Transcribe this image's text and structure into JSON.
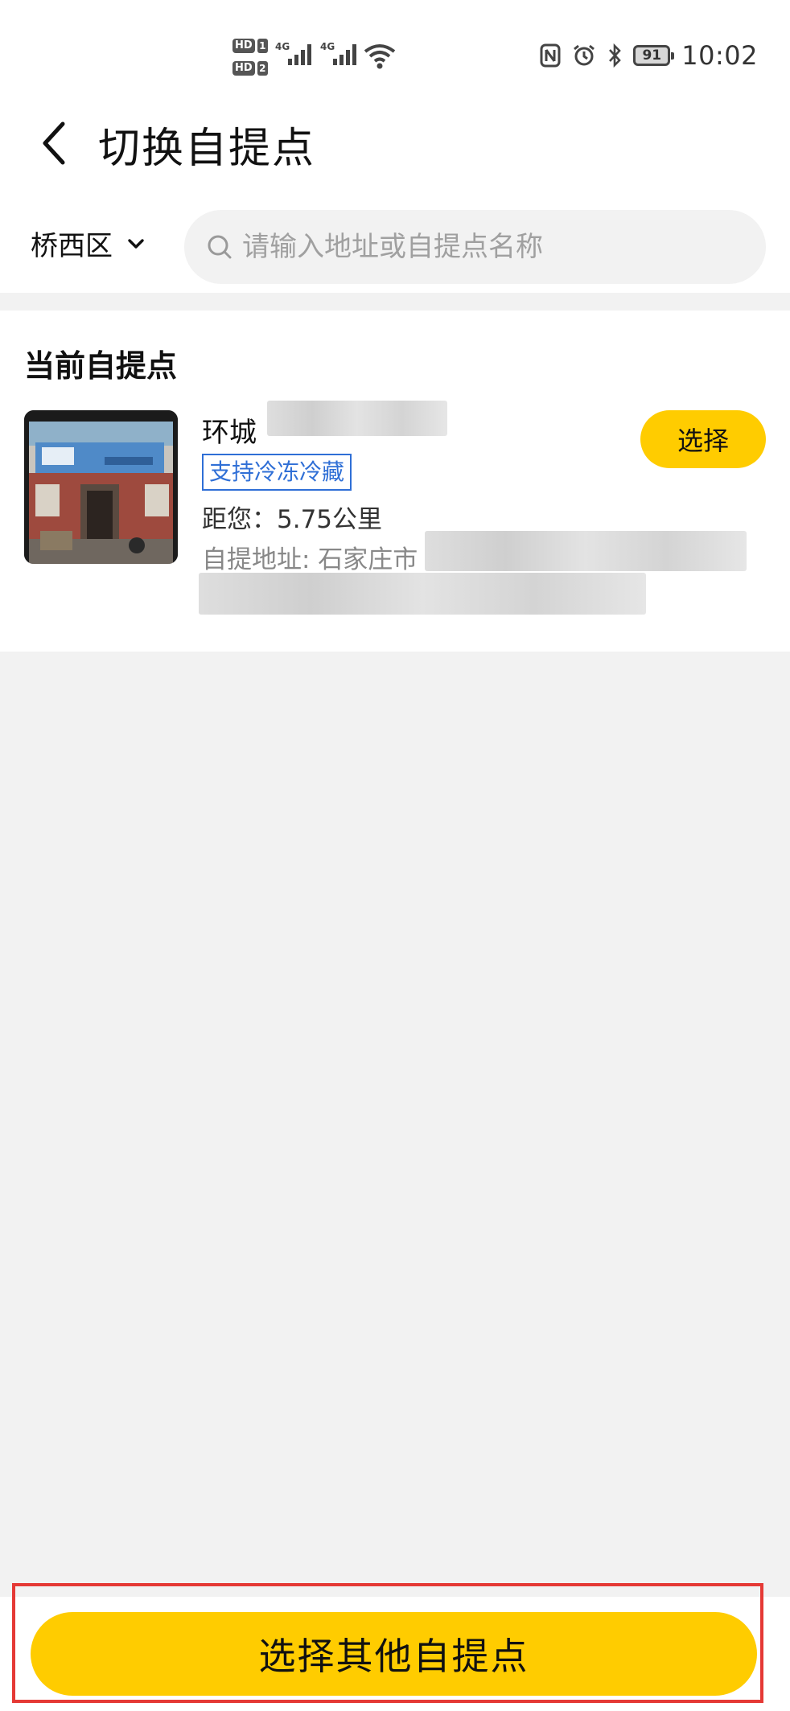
{
  "status_bar": {
    "sim1": "HD",
    "sim1_num": "1",
    "sim2": "HD",
    "sim2_num": "2",
    "network1": "4G",
    "network2": "4G",
    "battery": "91",
    "time": "10:02"
  },
  "header": {
    "title": "切换自提点"
  },
  "filter": {
    "district": "桥西区",
    "search_placeholder": "请输入地址或自提点名称"
  },
  "current": {
    "section_title": "当前自提点",
    "name": "环城",
    "tag": "支持冷冻冷藏",
    "distance": "距您：5.75公里",
    "address": "自提地址: 石家庄市",
    "select_label": "选择"
  },
  "footer": {
    "button_label": "选择其他自提点"
  },
  "colors": {
    "accent": "#ffcc00",
    "tag_blue": "#2f6fd6",
    "highlight_red": "#e53935"
  }
}
